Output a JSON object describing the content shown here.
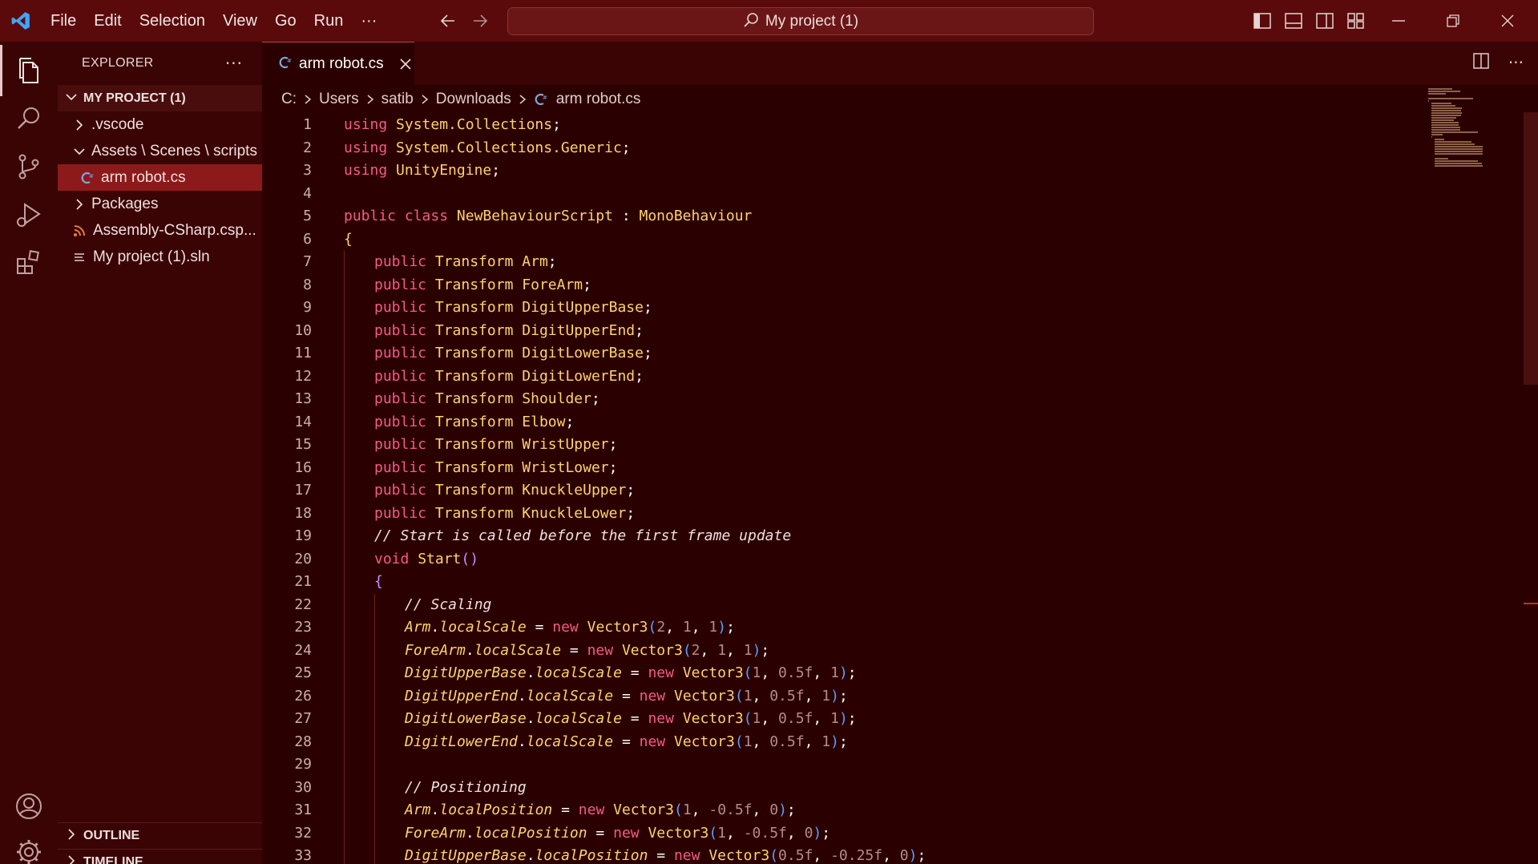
{
  "window": {
    "menu": [
      "File",
      "Edit",
      "Selection",
      "View",
      "Go",
      "Run",
      "···"
    ],
    "command_center": "My project (1)"
  },
  "sidebar": {
    "title": "EXPLORER",
    "more": "···",
    "project": "MY PROJECT (1)",
    "tree": [
      {
        "label": ".vscode",
        "kind": "folder-collapsed",
        "indent": 1
      },
      {
        "label": "Assets \\ Scenes \\ scripts",
        "kind": "folder-expanded",
        "indent": 1
      },
      {
        "label": "arm robot.cs",
        "kind": "csharp-file",
        "indent": 2,
        "selected": true
      },
      {
        "label": "Packages",
        "kind": "folder-collapsed",
        "indent": 1
      },
      {
        "label": "Assembly-CSharp.csp...",
        "kind": "rss-file",
        "indent": 1
      },
      {
        "label": "My project (1).sln",
        "kind": "list-file",
        "indent": 1
      }
    ],
    "outline": "OUTLINE",
    "timeline": "TIMELINE"
  },
  "editor": {
    "tab_label": "arm robot.cs",
    "breadcrumb": [
      "C:",
      "Users",
      "satib",
      "Downloads",
      "arm robot.cs"
    ]
  },
  "colors": {
    "titlebar": "#5a0a0a",
    "sidebar": "#3a0404",
    "editor_bg": "#2b0000",
    "selection": "#8c1a1a",
    "keyword": "#f55a8a",
    "type": "#ffd36e"
  },
  "code": [
    {
      "n": "1",
      "indent": 0,
      "tokens": [
        [
          "kw",
          "using"
        ],
        [
          "id",
          " "
        ],
        [
          "ty",
          "System.Collections"
        ],
        [
          "id",
          ";"
        ]
      ]
    },
    {
      "n": "2",
      "indent": 0,
      "tokens": [
        [
          "kw",
          "using"
        ],
        [
          "id",
          " "
        ],
        [
          "ty",
          "System.Collections.Generic"
        ],
        [
          "id",
          ";"
        ]
      ]
    },
    {
      "n": "3",
      "indent": 0,
      "tokens": [
        [
          "kw",
          "using"
        ],
        [
          "id",
          " "
        ],
        [
          "ty",
          "UnityEngine"
        ],
        [
          "id",
          ";"
        ]
      ]
    },
    {
      "n": "4",
      "indent": 0,
      "tokens": []
    },
    {
      "n": "5",
      "indent": 0,
      "tokens": [
        [
          "kw",
          "public"
        ],
        [
          "id",
          " "
        ],
        [
          "kw",
          "class"
        ],
        [
          "id",
          " "
        ],
        [
          "ty",
          "NewBehaviourScript"
        ],
        [
          "id",
          " : "
        ],
        [
          "ty",
          "MonoBehaviour"
        ]
      ]
    },
    {
      "n": "6",
      "indent": 0,
      "tokens": [
        [
          "br",
          "{"
        ]
      ]
    },
    {
      "n": "7",
      "indent": 1,
      "tokens": [
        [
          "kw",
          "public"
        ],
        [
          "id",
          " "
        ],
        [
          "ty",
          "Transform"
        ],
        [
          "id",
          " "
        ],
        [
          "ty",
          "Arm"
        ],
        [
          "id",
          ";"
        ]
      ]
    },
    {
      "n": "8",
      "indent": 1,
      "tokens": [
        [
          "kw",
          "public"
        ],
        [
          "id",
          " "
        ],
        [
          "ty",
          "Transform"
        ],
        [
          "id",
          " "
        ],
        [
          "ty",
          "ForeArm"
        ],
        [
          "id",
          ";"
        ]
      ]
    },
    {
      "n": "9",
      "indent": 1,
      "tokens": [
        [
          "kw",
          "public"
        ],
        [
          "id",
          " "
        ],
        [
          "ty",
          "Transform"
        ],
        [
          "id",
          " "
        ],
        [
          "ty",
          "DigitUpperBase"
        ],
        [
          "id",
          ";"
        ]
      ]
    },
    {
      "n": "10",
      "indent": 1,
      "tokens": [
        [
          "kw",
          "public"
        ],
        [
          "id",
          " "
        ],
        [
          "ty",
          "Transform"
        ],
        [
          "id",
          " "
        ],
        [
          "ty",
          "DigitUpperEnd"
        ],
        [
          "id",
          ";"
        ]
      ]
    },
    {
      "n": "11",
      "indent": 1,
      "tokens": [
        [
          "kw",
          "public"
        ],
        [
          "id",
          " "
        ],
        [
          "ty",
          "Transform"
        ],
        [
          "id",
          " "
        ],
        [
          "ty",
          "DigitLowerBase"
        ],
        [
          "id",
          ";"
        ]
      ]
    },
    {
      "n": "12",
      "indent": 1,
      "tokens": [
        [
          "kw",
          "public"
        ],
        [
          "id",
          " "
        ],
        [
          "ty",
          "Transform"
        ],
        [
          "id",
          " "
        ],
        [
          "ty",
          "DigitLowerEnd"
        ],
        [
          "id",
          ";"
        ]
      ]
    },
    {
      "n": "13",
      "indent": 1,
      "tokens": [
        [
          "kw",
          "public"
        ],
        [
          "id",
          " "
        ],
        [
          "ty",
          "Transform"
        ],
        [
          "id",
          " "
        ],
        [
          "ty",
          "Shoulder"
        ],
        [
          "id",
          ";"
        ]
      ]
    },
    {
      "n": "14",
      "indent": 1,
      "tokens": [
        [
          "kw",
          "public"
        ],
        [
          "id",
          " "
        ],
        [
          "ty",
          "Transform"
        ],
        [
          "id",
          " "
        ],
        [
          "ty",
          "Elbow"
        ],
        [
          "id",
          ";"
        ]
      ]
    },
    {
      "n": "15",
      "indent": 1,
      "tokens": [
        [
          "kw",
          "public"
        ],
        [
          "id",
          " "
        ],
        [
          "ty",
          "Transform"
        ],
        [
          "id",
          " "
        ],
        [
          "ty",
          "WristUpper"
        ],
        [
          "id",
          ";"
        ]
      ]
    },
    {
      "n": "16",
      "indent": 1,
      "tokens": [
        [
          "kw",
          "public"
        ],
        [
          "id",
          " "
        ],
        [
          "ty",
          "Transform"
        ],
        [
          "id",
          " "
        ],
        [
          "ty",
          "WristLower"
        ],
        [
          "id",
          ";"
        ]
      ]
    },
    {
      "n": "17",
      "indent": 1,
      "tokens": [
        [
          "kw",
          "public"
        ],
        [
          "id",
          " "
        ],
        [
          "ty",
          "Transform"
        ],
        [
          "id",
          " "
        ],
        [
          "ty",
          "KnuckleUpper"
        ],
        [
          "id",
          ";"
        ]
      ]
    },
    {
      "n": "18",
      "indent": 1,
      "tokens": [
        [
          "kw",
          "public"
        ],
        [
          "id",
          " "
        ],
        [
          "ty",
          "Transform"
        ],
        [
          "id",
          " "
        ],
        [
          "ty",
          "KnuckleLower"
        ],
        [
          "id",
          ";"
        ]
      ]
    },
    {
      "n": "19",
      "indent": 1,
      "tokens": [
        [
          "cm",
          "// Start is called before the first frame update"
        ]
      ]
    },
    {
      "n": "20",
      "indent": 1,
      "tokens": [
        [
          "kw",
          "void"
        ],
        [
          "id",
          " "
        ],
        [
          "fn",
          "Start"
        ],
        [
          "pa",
          "()"
        ]
      ]
    },
    {
      "n": "21",
      "indent": 1,
      "tokens": [
        [
          "pa",
          "{"
        ]
      ]
    },
    {
      "n": "22",
      "indent": 2,
      "tokens": [
        [
          "cm",
          "// Scaling"
        ]
      ]
    },
    {
      "n": "23",
      "indent": 2,
      "tokens": [
        [
          "mb",
          "Arm"
        ],
        [
          "id",
          "."
        ],
        [
          "pr",
          "localScale"
        ],
        [
          "id",
          " = "
        ],
        [
          "kw",
          "new"
        ],
        [
          "id",
          " "
        ],
        [
          "ty",
          "Vector3"
        ],
        [
          "pb",
          "("
        ],
        [
          "nm",
          "2"
        ],
        [
          "id",
          ", "
        ],
        [
          "nm",
          "1"
        ],
        [
          "id",
          ", "
        ],
        [
          "nm",
          "1"
        ],
        [
          "pb",
          ")"
        ],
        [
          "id",
          ";"
        ]
      ]
    },
    {
      "n": "24",
      "indent": 2,
      "tokens": [
        [
          "mb",
          "ForeArm"
        ],
        [
          "id",
          "."
        ],
        [
          "pr",
          "localScale"
        ],
        [
          "id",
          " = "
        ],
        [
          "kw",
          "new"
        ],
        [
          "id",
          " "
        ],
        [
          "ty",
          "Vector3"
        ],
        [
          "pb",
          "("
        ],
        [
          "nm",
          "2"
        ],
        [
          "id",
          ", "
        ],
        [
          "nm",
          "1"
        ],
        [
          "id",
          ", "
        ],
        [
          "nm",
          "1"
        ],
        [
          "pb",
          ")"
        ],
        [
          "id",
          ";"
        ]
      ]
    },
    {
      "n": "25",
      "indent": 2,
      "tokens": [
        [
          "mb",
          "DigitUpperBase"
        ],
        [
          "id",
          "."
        ],
        [
          "pr",
          "localScale"
        ],
        [
          "id",
          " = "
        ],
        [
          "kw",
          "new"
        ],
        [
          "id",
          " "
        ],
        [
          "ty",
          "Vector3"
        ],
        [
          "pb",
          "("
        ],
        [
          "nm",
          "1"
        ],
        [
          "id",
          ", "
        ],
        [
          "nm",
          "0.5f"
        ],
        [
          "id",
          ", "
        ],
        [
          "nm",
          "1"
        ],
        [
          "pb",
          ")"
        ],
        [
          "id",
          ";"
        ]
      ]
    },
    {
      "n": "26",
      "indent": 2,
      "tokens": [
        [
          "mb",
          "DigitUpperEnd"
        ],
        [
          "id",
          "."
        ],
        [
          "pr",
          "localScale"
        ],
        [
          "id",
          " = "
        ],
        [
          "kw",
          "new"
        ],
        [
          "id",
          " "
        ],
        [
          "ty",
          "Vector3"
        ],
        [
          "pb",
          "("
        ],
        [
          "nm",
          "1"
        ],
        [
          "id",
          ", "
        ],
        [
          "nm",
          "0.5f"
        ],
        [
          "id",
          ", "
        ],
        [
          "nm",
          "1"
        ],
        [
          "pb",
          ")"
        ],
        [
          "id",
          ";"
        ]
      ]
    },
    {
      "n": "27",
      "indent": 2,
      "tokens": [
        [
          "mb",
          "DigitLowerBase"
        ],
        [
          "id",
          "."
        ],
        [
          "pr",
          "localScale"
        ],
        [
          "id",
          " = "
        ],
        [
          "kw",
          "new"
        ],
        [
          "id",
          " "
        ],
        [
          "ty",
          "Vector3"
        ],
        [
          "pb",
          "("
        ],
        [
          "nm",
          "1"
        ],
        [
          "id",
          ", "
        ],
        [
          "nm",
          "0.5f"
        ],
        [
          "id",
          ", "
        ],
        [
          "nm",
          "1"
        ],
        [
          "pb",
          ")"
        ],
        [
          "id",
          ";"
        ]
      ]
    },
    {
      "n": "28",
      "indent": 2,
      "tokens": [
        [
          "mb",
          "DigitLowerEnd"
        ],
        [
          "id",
          "."
        ],
        [
          "pr",
          "localScale"
        ],
        [
          "id",
          " = "
        ],
        [
          "kw",
          "new"
        ],
        [
          "id",
          " "
        ],
        [
          "ty",
          "Vector3"
        ],
        [
          "pb",
          "("
        ],
        [
          "nm",
          "1"
        ],
        [
          "id",
          ", "
        ],
        [
          "nm",
          "0.5f"
        ],
        [
          "id",
          ", "
        ],
        [
          "nm",
          "1"
        ],
        [
          "pb",
          ")"
        ],
        [
          "id",
          ";"
        ]
      ]
    },
    {
      "n": "29",
      "indent": 2,
      "tokens": []
    },
    {
      "n": "30",
      "indent": 2,
      "tokens": [
        [
          "cm",
          "// Positioning"
        ]
      ]
    },
    {
      "n": "31",
      "indent": 2,
      "tokens": [
        [
          "mb",
          "Arm"
        ],
        [
          "id",
          "."
        ],
        [
          "pr",
          "localPosition"
        ],
        [
          "id",
          " = "
        ],
        [
          "kw",
          "new"
        ],
        [
          "id",
          " "
        ],
        [
          "ty",
          "Vector3"
        ],
        [
          "pb",
          "("
        ],
        [
          "nm",
          "1"
        ],
        [
          "id",
          ", "
        ],
        [
          "nm",
          "-0.5f"
        ],
        [
          "id",
          ", "
        ],
        [
          "nm",
          "0"
        ],
        [
          "pb",
          ")"
        ],
        [
          "id",
          ";"
        ]
      ]
    },
    {
      "n": "32",
      "indent": 2,
      "tokens": [
        [
          "mb",
          "ForeArm"
        ],
        [
          "id",
          "."
        ],
        [
          "pr",
          "localPosition"
        ],
        [
          "id",
          " = "
        ],
        [
          "kw",
          "new"
        ],
        [
          "id",
          " "
        ],
        [
          "ty",
          "Vector3"
        ],
        [
          "pb",
          "("
        ],
        [
          "nm",
          "1"
        ],
        [
          "id",
          ", "
        ],
        [
          "nm",
          "-0.5f"
        ],
        [
          "id",
          ", "
        ],
        [
          "nm",
          "0"
        ],
        [
          "pb",
          ")"
        ],
        [
          "id",
          ";"
        ]
      ]
    },
    {
      "n": "33",
      "indent": 2,
      "tokens": [
        [
          "mb",
          "DigitUpperBase"
        ],
        [
          "id",
          "."
        ],
        [
          "pr",
          "localPosition"
        ],
        [
          "id",
          " = "
        ],
        [
          "kw",
          "new"
        ],
        [
          "id",
          " "
        ],
        [
          "ty",
          "Vector3"
        ],
        [
          "pb",
          "("
        ],
        [
          "nm",
          "0.5f"
        ],
        [
          "id",
          ", "
        ],
        [
          "nm",
          "-0.25f"
        ],
        [
          "id",
          ", "
        ],
        [
          "nm",
          "0"
        ],
        [
          "pb",
          ")"
        ],
        [
          "id",
          ";"
        ]
      ]
    }
  ]
}
